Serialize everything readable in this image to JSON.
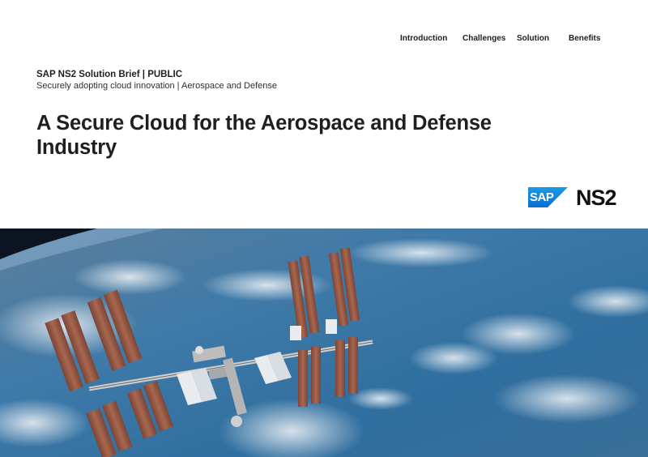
{
  "nav": {
    "items": [
      {
        "label": "Introduction"
      },
      {
        "label": "Challenges"
      },
      {
        "label": "Solution"
      },
      {
        "label": "Benefits"
      }
    ]
  },
  "header": {
    "brief_label": "SAP NS2 Solution Brief | PUBLIC",
    "subtitle": "Securely adopting cloud innovation | Aerospace and Defense"
  },
  "title": {
    "line1": "A Secure Cloud for the Aerospace and Defense",
    "line2": "Industry"
  },
  "logos": {
    "sap": "SAP",
    "ns2": "NS2"
  },
  "colors": {
    "sap_blue": "#0a6ed1",
    "earth_blue": "#3b78a8",
    "panel_copper": "#9a5a45"
  }
}
